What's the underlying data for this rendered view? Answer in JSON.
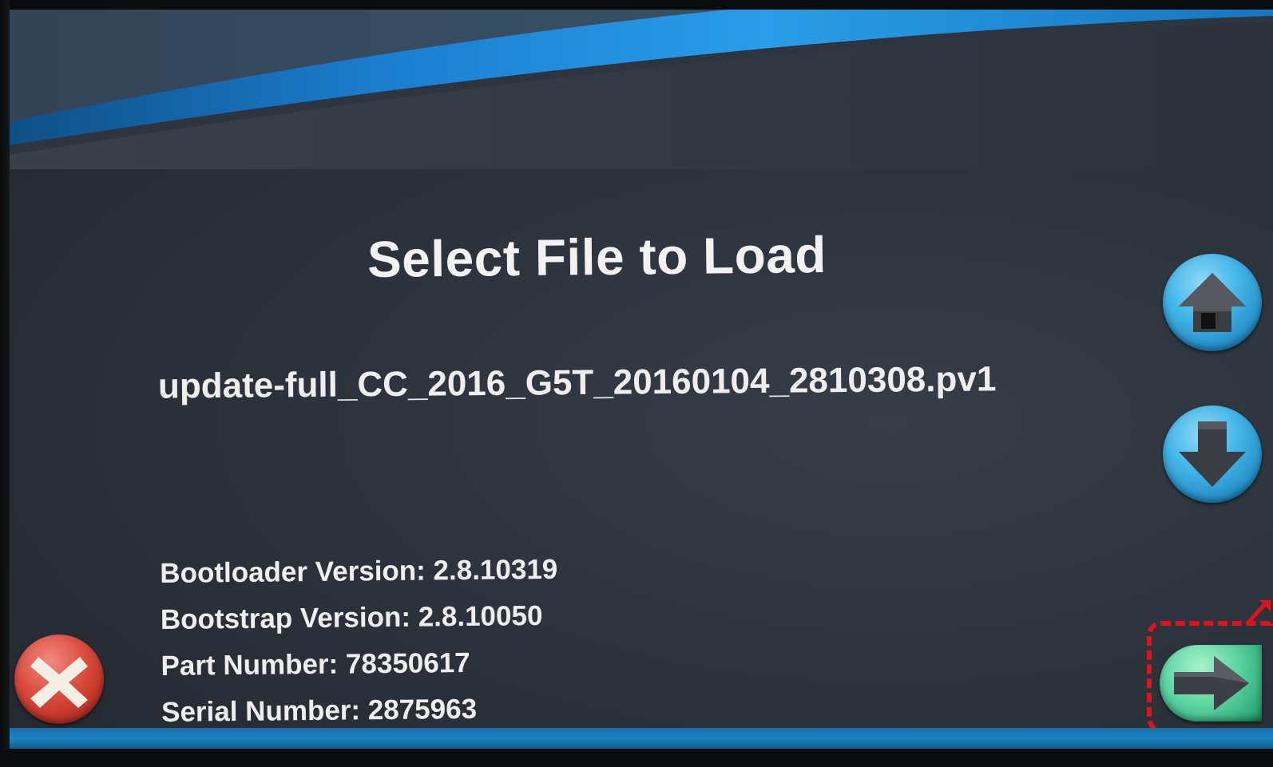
{
  "title": "Select File to Load",
  "file": {
    "selected_name": "update-full_CC_2016_G5T_20160104_2810308.pv1"
  },
  "device_info": {
    "bootloader": "Bootloader Version: 2.8.10319",
    "bootstrap": "Bootstrap Version: 2.8.10050",
    "part_number": "Part Number: 78350617",
    "serial_number": "Serial Number: 2875963"
  },
  "buttons": {
    "up_icon": "arrow-up-icon",
    "down_icon": "arrow-down-icon",
    "next_icon": "arrow-right-icon",
    "cancel_icon": "x-icon"
  },
  "colors": {
    "background": "#2d333c",
    "accent_blue": "#1e82c4",
    "cancel_red": "#d94a3c",
    "next_green": "#5fd6a4",
    "annotation_red": "#e0121b"
  }
}
